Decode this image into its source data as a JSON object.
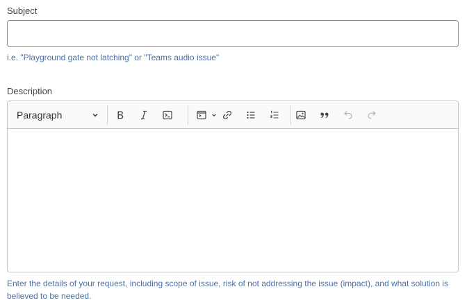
{
  "subject": {
    "label": "Subject",
    "value": "",
    "help": "i.e. \"Playground gate not latching\" or \"Teams audio issue\""
  },
  "description": {
    "label": "Description",
    "help": "Enter the details of your request, including scope of issue, risk of not addressing the issue (impact), and what solution is believed to be needed.",
    "toolbar": {
      "heading_value": "Paragraph",
      "buttons": [
        "bold-icon",
        "italic-icon",
        "code-icon",
        "code-block-icon",
        "link-icon",
        "bulleted-list-icon",
        "numbered-list-icon",
        "image-icon",
        "blockquote-icon",
        "undo-icon",
        "redo-icon"
      ]
    }
  },
  "colors": {
    "help_text": "#4a6fa5",
    "border": "#8c8c8c",
    "disabled_icon": "#b5b5b5"
  }
}
